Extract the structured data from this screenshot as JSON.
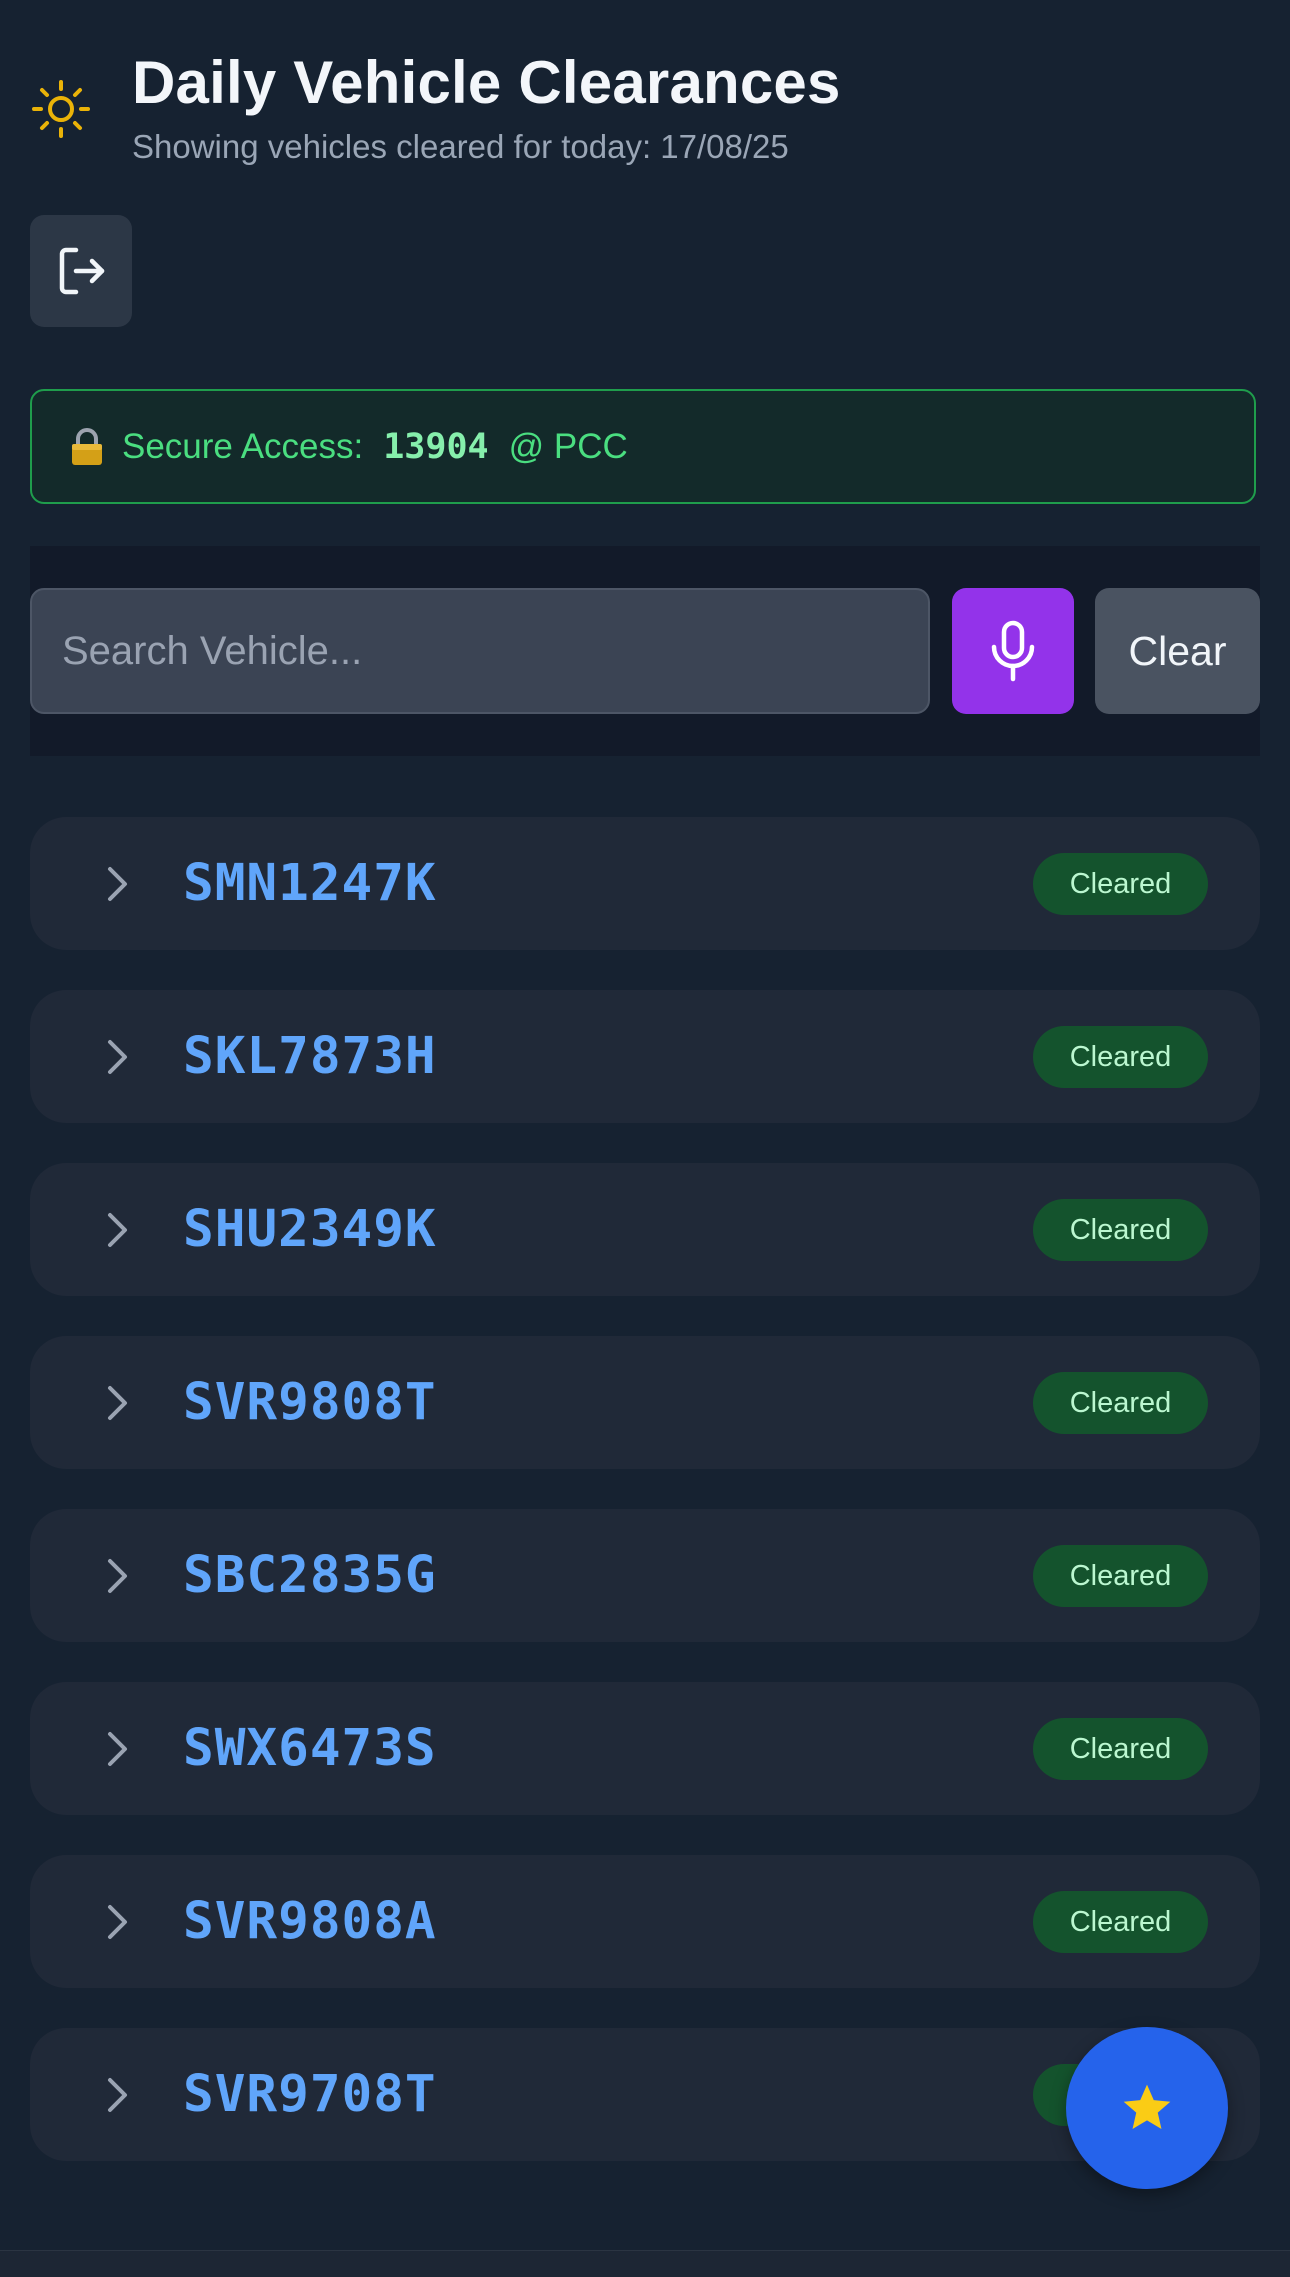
{
  "header": {
    "title": "Daily Vehicle Clearances",
    "subtitle": "Showing vehicles cleared for today: 17/08/25",
    "theme_icon": "sun-icon"
  },
  "logout": {
    "icon": "logout-icon"
  },
  "secure_access": {
    "icon": "lock-icon",
    "label": "Secure Access:",
    "code": "13904",
    "location": "@ PCC"
  },
  "search": {
    "placeholder": "Search Vehicle...",
    "value": "",
    "mic_icon": "microphone-icon",
    "clear_label": "Clear"
  },
  "vehicles": [
    {
      "plate": "SMN1247K",
      "status": "Cleared"
    },
    {
      "plate": "SKL7873H",
      "status": "Cleared"
    },
    {
      "plate": "SHU2349K",
      "status": "Cleared"
    },
    {
      "plate": "SVR9808T",
      "status": "Cleared"
    },
    {
      "plate": "SBC2835G",
      "status": "Cleared"
    },
    {
      "plate": "SWX6473S",
      "status": "Cleared"
    },
    {
      "plate": "SVR9808A",
      "status": "Cleared"
    },
    {
      "plate": "SVR9708T",
      "status": "Cleared"
    }
  ],
  "fab": {
    "icon": "star-icon"
  },
  "colors": {
    "background": "#162231",
    "accent_purple": "#9333ea",
    "fab_blue": "#2563eb",
    "plate_blue": "#60a5fa",
    "badge_green": "#14532d",
    "secure_green": "#4ade80",
    "sun_yellow": "#eab308"
  }
}
